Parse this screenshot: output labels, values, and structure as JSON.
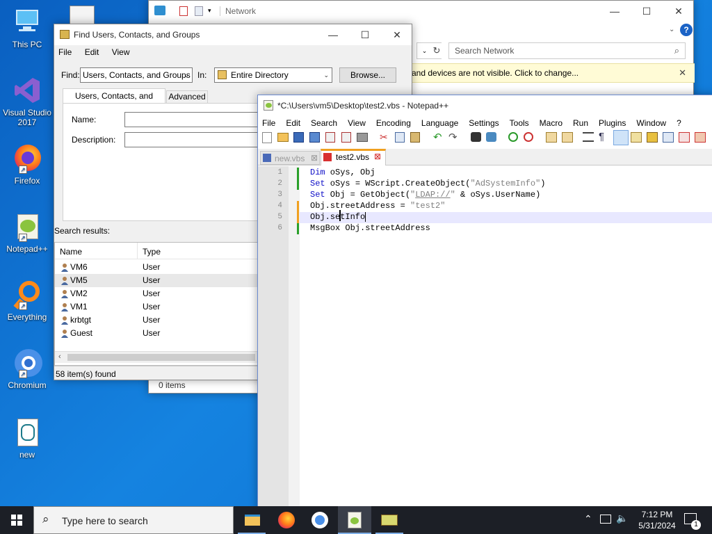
{
  "desktop": {
    "icons": [
      {
        "label": "This PC",
        "icon": "computer-icon"
      },
      {
        "label": "Visual Studio 2017",
        "icon": "visual-studio-icon"
      },
      {
        "label": "Firefox",
        "icon": "firefox-icon"
      },
      {
        "label": "Notepad++",
        "icon": "notepadpp-icon"
      },
      {
        "label": "Everything",
        "icon": "everything-search-icon"
      },
      {
        "label": "Chromium",
        "icon": "chromium-icon"
      },
      {
        "label": "new",
        "icon": "script-file-icon"
      }
    ]
  },
  "network_window": {
    "title": "Network",
    "search_placeholder": "Search Network",
    "info_bar": "and devices are not visible. Click to change...",
    "status": "0 items"
  },
  "find_window": {
    "title": "Find Users, Contacts, and Groups",
    "menu": [
      "File",
      "Edit",
      "View"
    ],
    "find_label": "Find:",
    "find_value": "Users, Contacts, and Groups",
    "in_label": "In:",
    "in_value": "Entire Directory",
    "browse_label": "Browse...",
    "tabs": [
      "Users, Contacts, and Groups",
      "Advanced"
    ],
    "name_label": "Name:",
    "description_label": "Description:",
    "results_label": "Search results:",
    "columns": [
      "Name",
      "Type"
    ],
    "rows": [
      {
        "name": "VM6",
        "type": "User"
      },
      {
        "name": "VM5",
        "type": "User"
      },
      {
        "name": "VM2",
        "type": "User"
      },
      {
        "name": "VM1",
        "type": "User"
      },
      {
        "name": "krbtgt",
        "type": "User"
      },
      {
        "name": "Guest",
        "type": "User"
      }
    ],
    "status": "58 item(s) found"
  },
  "notepad": {
    "title": "*C:\\Users\\vm5\\Desktop\\test2.vbs - Notepad++",
    "menu": [
      "File",
      "Edit",
      "Search",
      "View",
      "Encoding",
      "Language",
      "Settings",
      "Tools",
      "Macro",
      "Run",
      "Plugins",
      "Window",
      "?"
    ],
    "tabs": [
      "new.vbs",
      "test2.vbs"
    ],
    "line_numbers": [
      "1",
      "2",
      "3",
      "4",
      "5",
      "6"
    ],
    "code": {
      "l1_kw": "Dim",
      "l1_rest": " oSys, Obj",
      "l2_kw": "Set",
      "l2_rest": " oSys = WScript.CreateObject(",
      "l2_str": "\"AdSystemInfo\"",
      "l2_end": ")",
      "l3_kw": "Set",
      "l3_rest": " Obj = GetObject(",
      "l3_str1": "\"",
      "l3_link": "LDAP://",
      "l3_str2": "\"",
      "l3_end": " & oSys.UserName)",
      "l4_rest": "Obj.streetAddress = ",
      "l4_str": "\"test2\"",
      "l5": "Obj.setInfo",
      "l6": "MsgBox Obj.streetAddress"
    }
  },
  "taskbar": {
    "search_placeholder": "Type here to search",
    "time": "7:12 PM",
    "date": "5/31/2024",
    "notification_count": "1"
  },
  "colors": {
    "desktop": "#0e6fcf",
    "taskbar": "#1c1f26",
    "keyword": "#1010c8",
    "string": "#808080"
  }
}
